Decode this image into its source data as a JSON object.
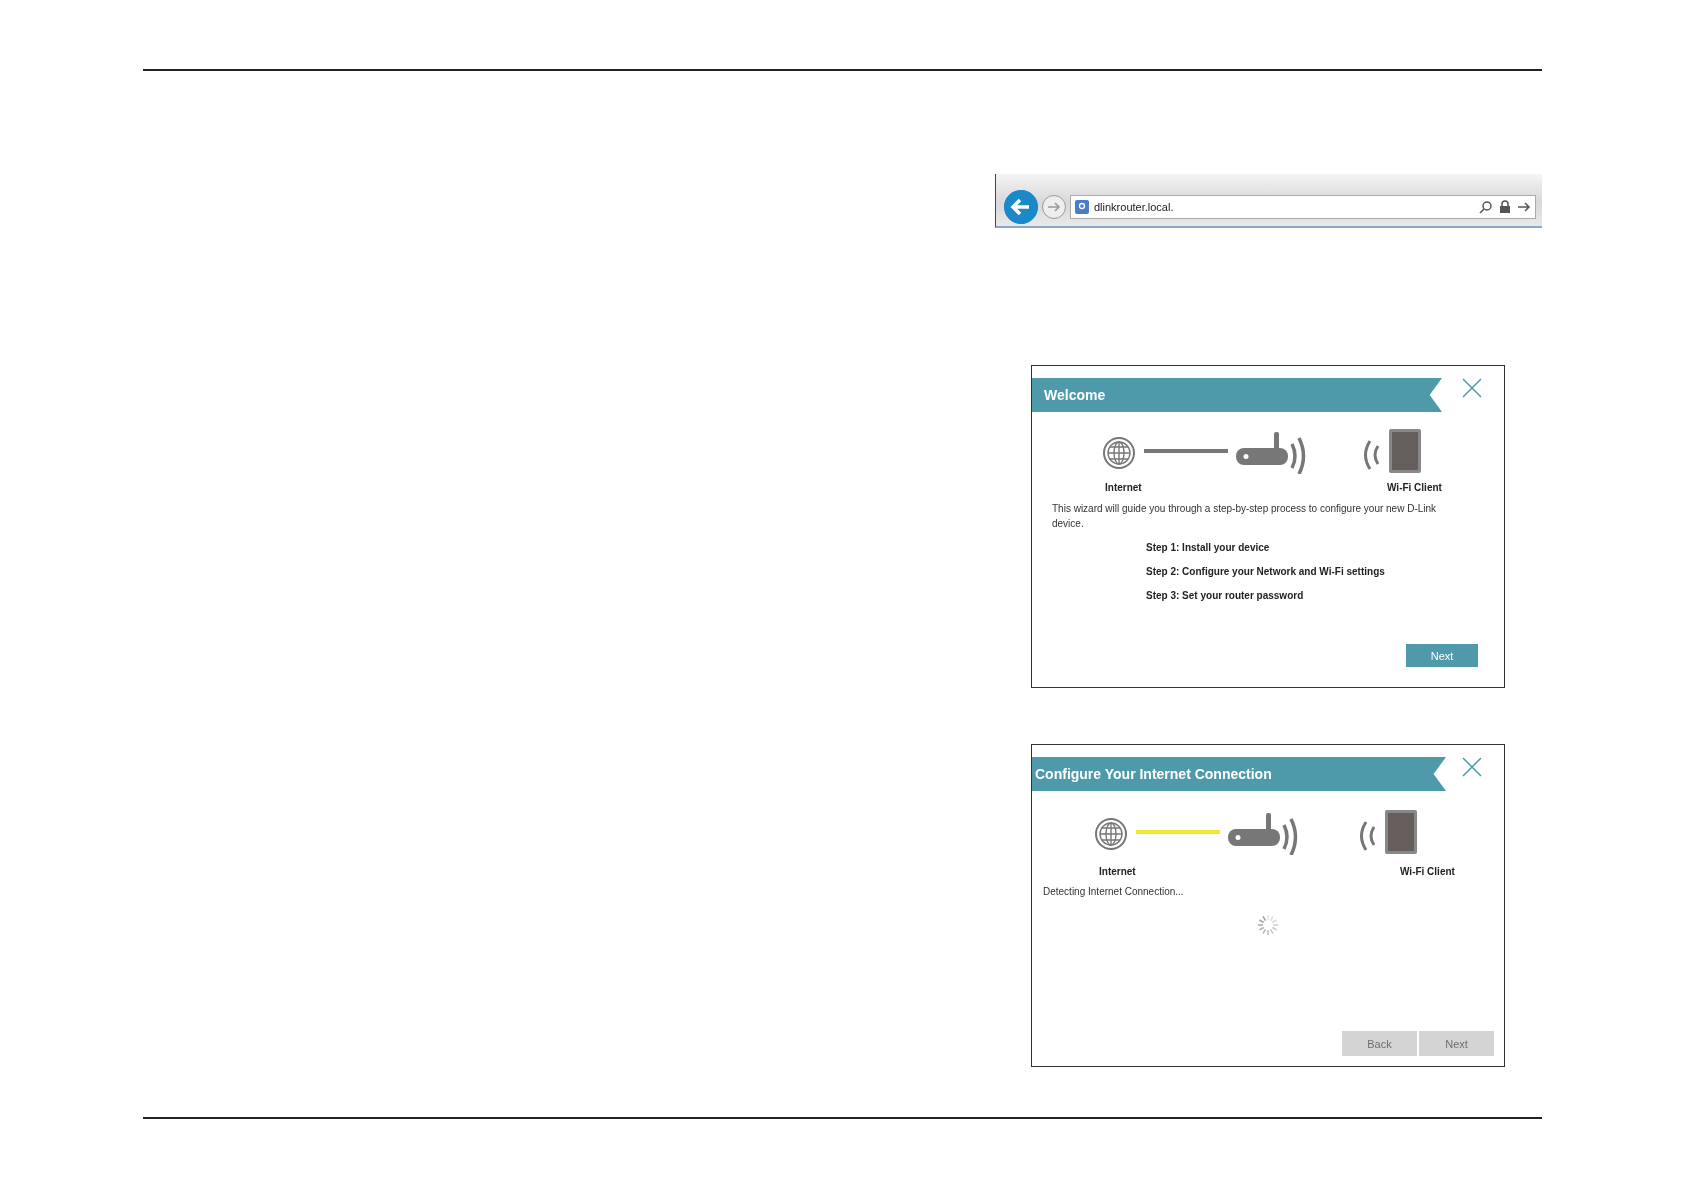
{
  "browser": {
    "address": "dlinkrouter.local."
  },
  "dialogs": [
    {
      "title": "Welcome",
      "link_active": false,
      "internet_label": "Internet",
      "client_label": "Wi-Fi Client",
      "text": "This wizard will guide you through a step-by-step process to configure your new D-Link device.",
      "steps": [
        "Step 1: Install your device",
        "Step 2: Configure your Network and Wi-Fi settings",
        "Step 3: Set your router password"
      ],
      "loading": false,
      "buttons": [
        {
          "label": "Next",
          "disabled": false
        }
      ]
    },
    {
      "title": "Configure Your Internet Connection",
      "link_active": true,
      "internet_label": "Internet",
      "client_label": "Wi-Fi Client",
      "text": "Detecting Internet Connection...",
      "loading": true,
      "buttons": [
        {
          "label": "Back",
          "disabled": true
        },
        {
          "label": "Next",
          "disabled": true
        }
      ]
    }
  ]
}
